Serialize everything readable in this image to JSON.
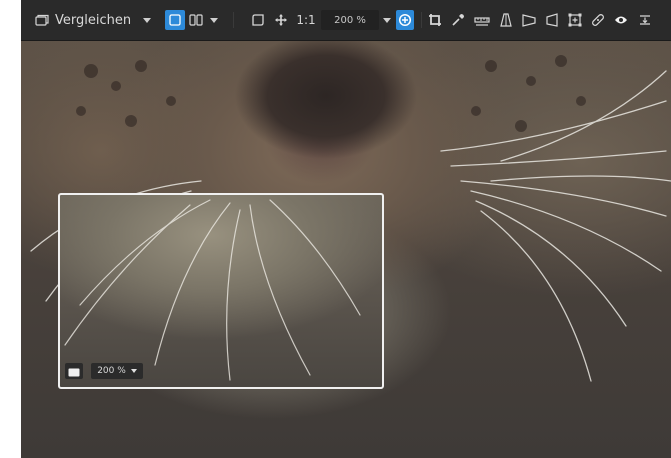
{
  "toolbar": {
    "compare_label": "Vergleichen",
    "actual_size_label": "1:1",
    "zoom_value": "200 %"
  },
  "loupe": {
    "zoom_value": "200 %"
  },
  "icons": [
    "compare-icon",
    "single-view-icon",
    "split-view-icon",
    "crop-frame-icon",
    "pan-icon",
    "zoom-in-icon",
    "crop-icon",
    "eyedropper-icon",
    "straighten-icon",
    "perspective-vertical-icon",
    "perspective-horizontal-icon",
    "perspective-full-icon",
    "transform-icon",
    "healing-icon",
    "red-eye-icon",
    "more-icon",
    "image-icon"
  ],
  "accent_color": "#2d8ad9"
}
